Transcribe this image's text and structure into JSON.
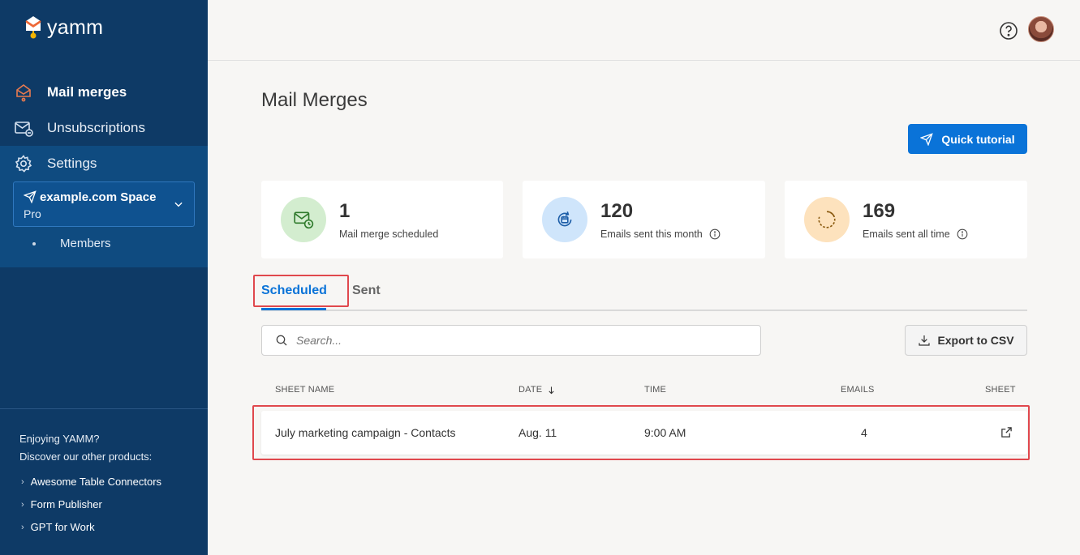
{
  "brand": {
    "name": "yamm"
  },
  "sidebar": {
    "items": [
      {
        "label": "Mail merges",
        "icon": "mail-merge-icon",
        "active": true
      },
      {
        "label": "Unsubscriptions",
        "icon": "unsubscribe-icon",
        "active": false
      },
      {
        "label": "Settings",
        "icon": "gear-icon",
        "active": false
      }
    ],
    "space": {
      "name": "example.com Space",
      "plan": "Pro"
    },
    "sub_items": [
      {
        "label": "Members"
      }
    ],
    "promo": {
      "line1": "Enjoying YAMM?",
      "line2": "Discover our other products:",
      "links": [
        {
          "label": "Awesome Table Connectors"
        },
        {
          "label": "Form Publisher"
        },
        {
          "label": "GPT for Work"
        }
      ]
    }
  },
  "header": {
    "title": "Mail Merges",
    "tutorial_label": "Quick tutorial"
  },
  "stats": [
    {
      "value": "1",
      "label": "Mail merge scheduled",
      "color": "#d3edcf",
      "info": false
    },
    {
      "value": "120",
      "label": "Emails sent this month",
      "color": "#cfe5fb",
      "info": true
    },
    {
      "value": "169",
      "label": "Emails sent all time",
      "color": "#fde2bd",
      "info": true
    }
  ],
  "tabs": [
    {
      "label": "Scheduled",
      "active": true
    },
    {
      "label": "Sent",
      "active": false
    }
  ],
  "search": {
    "placeholder": "Search..."
  },
  "export_label": "Export to CSV",
  "table": {
    "columns": [
      "SHEET NAME",
      "DATE",
      "TIME",
      "EMAILS",
      "SHEET"
    ],
    "rows": [
      {
        "sheet_name": "July marketing campaign - Contacts",
        "date": "Aug. 11",
        "time": "9:00 AM",
        "emails": "4"
      }
    ]
  },
  "colors": {
    "sidebar": "#0e3a66",
    "accent": "#0a73d8",
    "highlight": "#e0484d"
  }
}
